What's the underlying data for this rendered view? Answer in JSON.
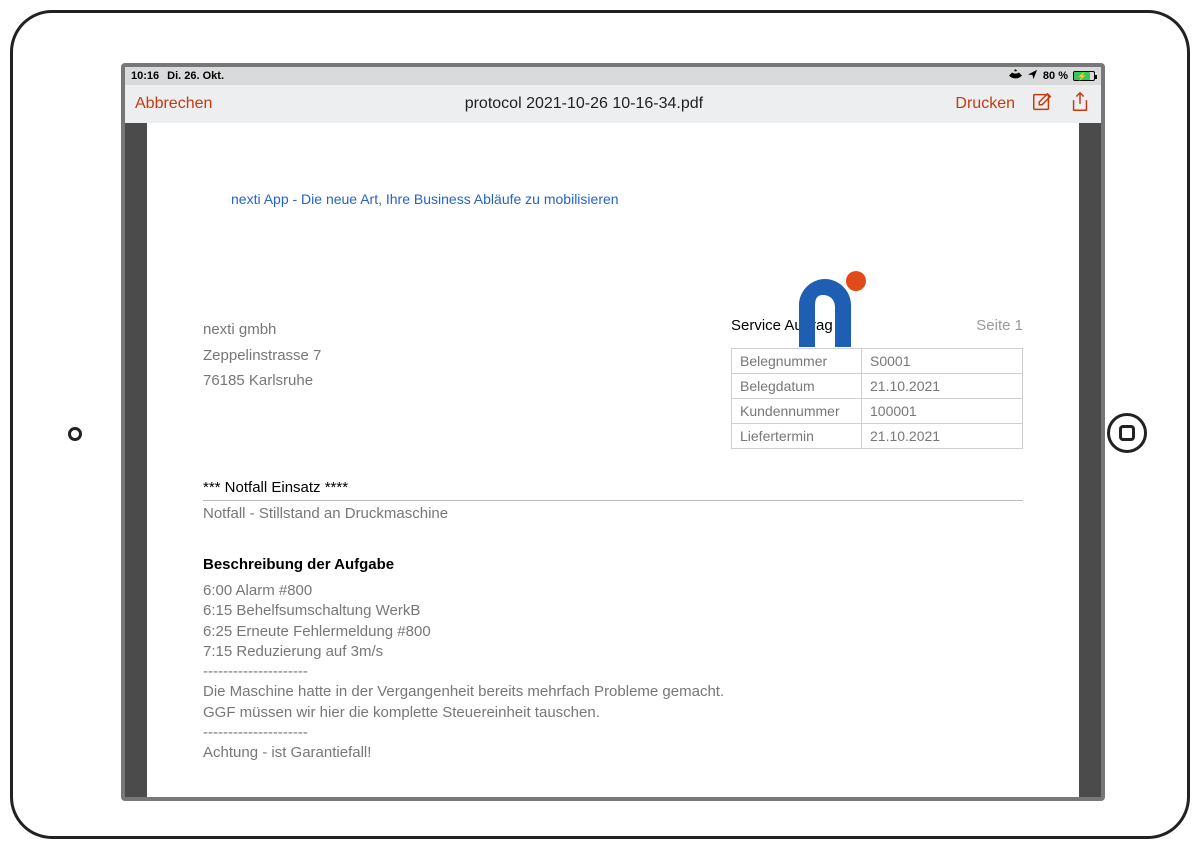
{
  "status": {
    "time": "10:16",
    "date": "Di. 26. Okt.",
    "battery_pct": "80 %"
  },
  "nav": {
    "cancel": "Abbrechen",
    "title": "protocol 2021-10-26 10-16-34.pdf",
    "print": "Drucken"
  },
  "doc": {
    "tagline": "nexti App - Die neue Art, Ihre Business Abläufe zu mobilisieren",
    "sender": {
      "name": "nexti gmbh",
      "street": "Zeppelinstrasse 7",
      "city": "76185 Karlsruhe"
    },
    "meta": {
      "title": "Service Auftrag",
      "page": "Seite 1",
      "rows": [
        {
          "label": "Belegnummer",
          "value": "S0001"
        },
        {
          "label": "Belegdatum",
          "value": "21.10.2021"
        },
        {
          "label": "Kundennummer",
          "value": "100001"
        },
        {
          "label": "Liefertermin",
          "value": "21.10.2021"
        }
      ]
    },
    "section": {
      "title": "*** Notfall Einsatz ****",
      "subtitle": "Notfall - Stillstand an Druckmaschine"
    },
    "description": {
      "heading": "Beschreibung der Aufgabe",
      "body": "6:00 Alarm #800\n6:15 Behelfsumschaltung WerkB\n6:25 Erneute Fehlermeldung #800\n7:15 Reduzierung auf 3m/s\n---------------------\nDie Maschine hatte in der Vergangenheit bereits mehrfach Probleme gemacht.\nGGF müssen wir hier die komplette Steuereinheit tauschen.\n---------------------\nAchtung - ist Garantiefall!"
    }
  }
}
